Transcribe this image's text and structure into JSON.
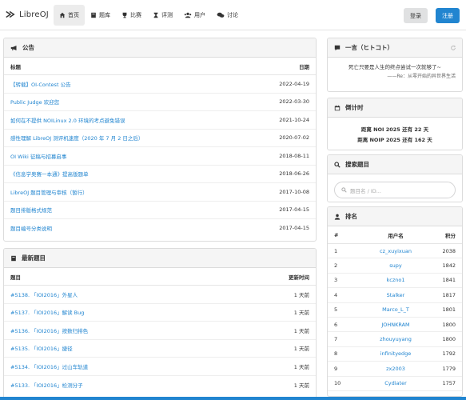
{
  "nav": {
    "brand": "LibreOJ",
    "items": [
      {
        "label": "首页",
        "icon": "home-icon",
        "active": true
      },
      {
        "label": "题库",
        "icon": "book-icon",
        "active": false
      },
      {
        "label": "比赛",
        "icon": "trophy-icon",
        "active": false
      },
      {
        "label": "评测",
        "icon": "hourglass-icon",
        "active": false
      },
      {
        "label": "用户",
        "icon": "users-icon",
        "active": false
      },
      {
        "label": "讨论",
        "icon": "comments-icon",
        "active": false
      }
    ],
    "login_label": "登录",
    "register_label": "注册"
  },
  "announcements": {
    "title": "公告",
    "col_title": "标题",
    "col_date": "日期",
    "rows": [
      {
        "title": "【转载】OI-Contest 公告",
        "date": "2022-04-19"
      },
      {
        "title": "Public Judge 欢迎您",
        "date": "2022-03-30"
      },
      {
        "title": "如何在不提供 NOILinux 2.0 环境的考点避免错误",
        "date": "2021-10-24"
      },
      {
        "title": "感性理解 LibreOJ 测评机速度（2020 年 7 月 2 日之后）",
        "date": "2020-07-02"
      },
      {
        "title": "OI Wiki 征稿与招募启事",
        "date": "2018-08-11"
      },
      {
        "title": "《信息学奥赛一本通》提高版题单",
        "date": "2018-06-26"
      },
      {
        "title": "LibreOJ 题目管理与审核（暂行）",
        "date": "2017-10-08"
      },
      {
        "title": "题目排版格式规范",
        "date": "2017-04-15"
      },
      {
        "title": "题目编号分类说明",
        "date": "2017-04-15"
      }
    ]
  },
  "latest": {
    "title": "最新题目",
    "col_title": "题目",
    "col_time": "更新时间",
    "rows": [
      {
        "title": "#5138. 「IOI2016」外星人",
        "time": "1 天前"
      },
      {
        "title": "#5137. 「IOI2016」解读 Bug",
        "time": "1 天前"
      },
      {
        "title": "#5136. 「IOI2016」按数归排色",
        "time": "1 天前"
      },
      {
        "title": "#5135. 「IOI2016」捷径",
        "time": "1 天前"
      },
      {
        "title": "#5134. 「IOI2016」过山车轨道",
        "time": "1 天前"
      },
      {
        "title": "#5133. 「IOI2016」检测分子",
        "time": "1 天前"
      }
    ]
  },
  "quote": {
    "title": "一言（ヒトコト）",
    "text": "死亡只要是人生的终点尝试一次就够了~",
    "from": "——Re：从零开始的异世界生活"
  },
  "countdown": {
    "title": "倒计时",
    "line1": "距离 NOI 2025 还有 22 天",
    "line2": "距离 NOIP 2025 还有 162 天"
  },
  "search": {
    "title": "搜索题目",
    "placeholder": "题目名 / ID..."
  },
  "ranking": {
    "title": "排名",
    "col_rank": "#",
    "col_user": "用户名",
    "col_score": "积分",
    "rows": [
      {
        "rank": "1",
        "user": "cz_xuyixuan",
        "score": "2038"
      },
      {
        "rank": "2",
        "user": "supy",
        "score": "1842"
      },
      {
        "rank": "3",
        "user": "kczno1",
        "score": "1841"
      },
      {
        "rank": "4",
        "user": "Stalker",
        "score": "1817"
      },
      {
        "rank": "5",
        "user": "Marco_L_T",
        "score": "1801"
      },
      {
        "rank": "6",
        "user": "JOHNKRAM",
        "score": "1800"
      },
      {
        "rank": "7",
        "user": "zhouyuyang",
        "score": "1800"
      },
      {
        "rank": "8",
        "user": "infinityedge",
        "score": "1792"
      },
      {
        "rank": "9",
        "user": "zx2003",
        "score": "1779"
      },
      {
        "rank": "10",
        "user": "Cydiater",
        "score": "1757"
      }
    ]
  },
  "colors": {
    "accent": "#2185d0",
    "link": "#2185d0"
  }
}
